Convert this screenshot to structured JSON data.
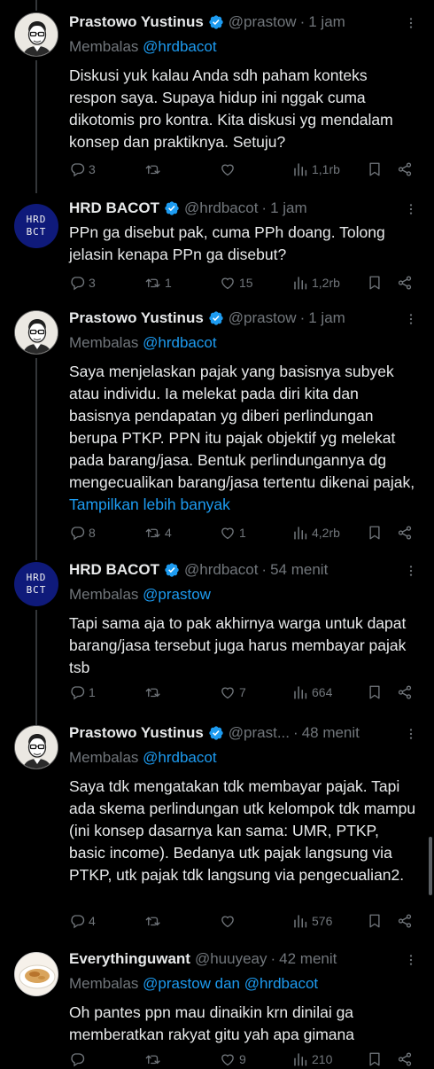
{
  "colors": {
    "background": "#000000",
    "text": "#e7e9ea",
    "muted": "#71767b",
    "link": "#1d9bf0",
    "verified": "#1d9bf0"
  },
  "tweets": [
    {
      "name": "Prastowo Yustinus",
      "handle": "@prastow",
      "dot": "·",
      "time": "1 jam",
      "replying_prefix": "Membalas ",
      "replying_to": "@hrdbacot",
      "body": "Diskusi yuk kalau Anda sdh paham konteks respon saya. Supaya hidup ini nggak cuma dikotomis pro kontra. Kita diskusi yg mendalam konsep dan praktiknya. Setuju?",
      "replies": "3",
      "retweets": "",
      "likes": "",
      "views": "1,1rb"
    },
    {
      "name": "HRD BACOT",
      "handle": "@hrdbacot",
      "dot": "·",
      "time": "1 jam",
      "avatar_text": [
        "HRD",
        "BCT"
      ],
      "body": "PPn ga disebut pak, cuma PPh doang. Tolong jelasin kenapa PPn ga disebut?",
      "replies": "3",
      "retweets": "1",
      "likes": "15",
      "views": "1,2rb"
    },
    {
      "name": "Prastowo Yustinus",
      "handle": "@prastow",
      "dot": "·",
      "time": "1 jam",
      "replying_prefix": "Membalas ",
      "replying_to": "@hrdbacot",
      "body": "Saya menjelaskan pajak yang basisnya subyek atau individu. Ia melekat pada diri kita dan basisnya pendapatan yg diberi perlindungan berupa PTKP. PPN itu pajak objektif yg melekat pada barang/jasa. Bentuk perlindungannya dg mengecualikan barang/jasa tertentu dikenai pajak,",
      "show_more": "Tampilkan lebih banyak",
      "replies": "8",
      "retweets": "4",
      "likes": "1",
      "views": "4,2rb"
    },
    {
      "name": "HRD BACOT",
      "handle": "@hrdbacot",
      "dot": "·",
      "time": "54 menit",
      "avatar_text": [
        "HRD",
        "BCT"
      ],
      "replying_prefix": "Membalas ",
      "replying_to": "@prastow",
      "body": "Tapi sama aja to pak akhirnya warga untuk dapat barang/jasa tersebut juga harus membayar pajak tsb",
      "replies": "1",
      "retweets": "",
      "likes": "7",
      "views": "664"
    },
    {
      "name": "Prastowo Yustinus",
      "handle": "@prast...",
      "dot": "·",
      "time": "48 menit",
      "replying_prefix": "Membalas ",
      "replying_to": "@hrdbacot",
      "body": "Saya tdk mengatakan tdk membayar pajak. Tapi ada skema perlindungan utk kelompok tdk mampu (ini konsep dasarnya kan sama: UMR, PTKP, basic income). Bedanya utk pajak langsung via PTKP, utk pajak tdk langsung via pengecualian2.",
      "replies": "4",
      "retweets": "",
      "likes": "",
      "views": "576"
    },
    {
      "name": "Everythinguwant",
      "handle": "@huuyeay",
      "dot": "·",
      "time": "42 menit",
      "replying_prefix": "Membalas ",
      "replying_to": "@prastow dan @hrdbacot",
      "body": "Oh pantes ppn mau dinaikin krn dinilai ga memberatkan rakyat gitu yah apa gimana",
      "replies": "",
      "retweets": "",
      "likes": "9",
      "views": "210"
    }
  ]
}
